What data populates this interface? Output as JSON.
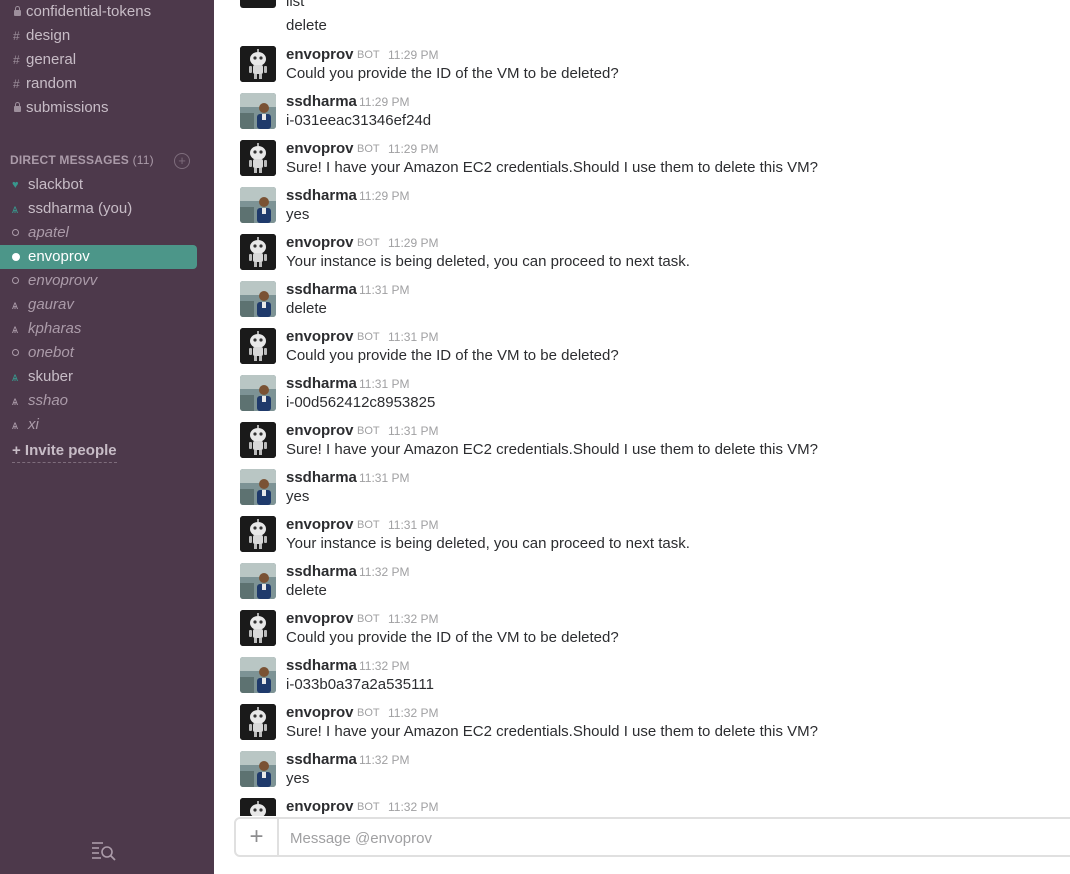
{
  "colors": {
    "sidebar_bg": "#4d394b",
    "active_bg": "#4c9689",
    "presence_online": "#38978d"
  },
  "sidebar": {
    "channels": [
      {
        "label": "confidential-tokens",
        "kind": "private"
      },
      {
        "label": "design",
        "kind": "public"
      },
      {
        "label": "general",
        "kind": "public"
      },
      {
        "label": "random",
        "kind": "public"
      },
      {
        "label": "submissions",
        "kind": "private"
      }
    ],
    "dm_header": "DIRECT MESSAGES",
    "dm_count": "(11)",
    "dms": [
      {
        "label": "slackbot",
        "presence": "heart"
      },
      {
        "label": "ssdharma (you)",
        "presence": "users"
      },
      {
        "label": "apatel",
        "presence": "away"
      },
      {
        "label": "envoprov",
        "presence": "online",
        "active": true
      },
      {
        "label": "envoprovv",
        "presence": "away"
      },
      {
        "label": "gaurav",
        "presence": "users-away"
      },
      {
        "label": "kpharas",
        "presence": "users-away"
      },
      {
        "label": "onebot",
        "presence": "away"
      },
      {
        "label": "skuber",
        "presence": "users"
      },
      {
        "label": "sshao",
        "presence": "users-away"
      },
      {
        "label": "xi",
        "presence": "users-away"
      }
    ],
    "invite_label": "+ Invite people",
    "search_icon": "search-list-icon"
  },
  "messages": {
    "top_fragments": [
      "list",
      "delete"
    ],
    "items": [
      {
        "sender": "envoprov",
        "bot": true,
        "time": "11:29 PM",
        "text": "Could you provide the ID of the VM to be deleted?"
      },
      {
        "sender": "ssdharma",
        "bot": false,
        "time": "11:29 PM",
        "text": "i-031eeac31346ef24d"
      },
      {
        "sender": "envoprov",
        "bot": true,
        "time": "11:29 PM",
        "text": "Sure! I have your Amazon EC2 credentials.Should I use them to delete this VM?"
      },
      {
        "sender": "ssdharma",
        "bot": false,
        "time": "11:29 PM",
        "text": "yes"
      },
      {
        "sender": "envoprov",
        "bot": true,
        "time": "11:29 PM",
        "text": "Your instance is being deleted, you can proceed to next task."
      },
      {
        "sender": "ssdharma",
        "bot": false,
        "time": "11:31 PM",
        "text": "delete"
      },
      {
        "sender": "envoprov",
        "bot": true,
        "time": "11:31 PM",
        "text": "Could you provide the ID of the VM to be deleted?"
      },
      {
        "sender": "ssdharma",
        "bot": false,
        "time": "11:31 PM",
        "text": "i-00d562412c8953825"
      },
      {
        "sender": "envoprov",
        "bot": true,
        "time": "11:31 PM",
        "text": "Sure! I have your Amazon EC2 credentials.Should I use them to delete this VM?"
      },
      {
        "sender": "ssdharma",
        "bot": false,
        "time": "11:31 PM",
        "text": "yes"
      },
      {
        "sender": "envoprov",
        "bot": true,
        "time": "11:31 PM",
        "text": "Your instance is being deleted, you can proceed to next task."
      },
      {
        "sender": "ssdharma",
        "bot": false,
        "time": "11:32 PM",
        "text": "delete"
      },
      {
        "sender": "envoprov",
        "bot": true,
        "time": "11:32 PM",
        "text": "Could you provide the ID of the VM to be deleted?"
      },
      {
        "sender": "ssdharma",
        "bot": false,
        "time": "11:32 PM",
        "text": "i-033b0a37a2a535111"
      },
      {
        "sender": "envoprov",
        "bot": true,
        "time": "11:32 PM",
        "text": "Sure! I have your Amazon EC2 credentials.Should I use them to delete this VM?"
      },
      {
        "sender": "ssdharma",
        "bot": false,
        "time": "11:32 PM",
        "text": "yes"
      },
      {
        "sender": "envoprov",
        "bot": true,
        "time": "11:32 PM",
        "text": ""
      }
    ],
    "bot_badge": "BOT"
  },
  "composer": {
    "placeholder": "Message @envoprov",
    "plus_label": "+"
  }
}
